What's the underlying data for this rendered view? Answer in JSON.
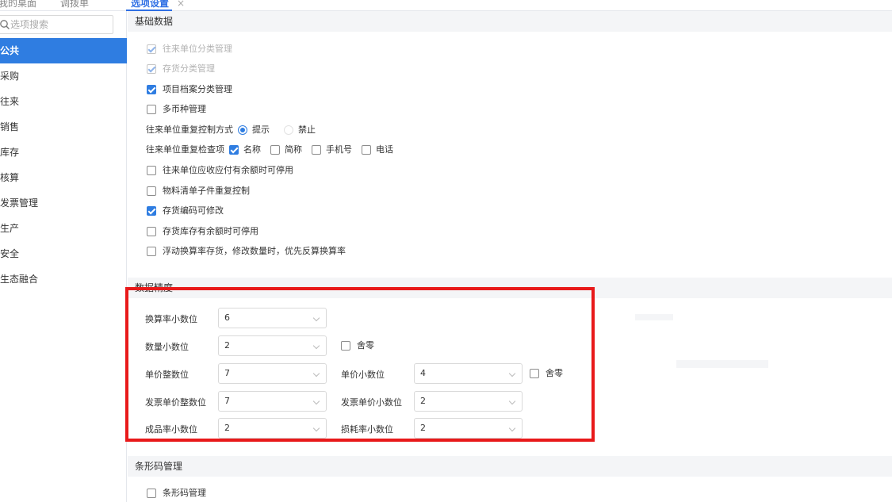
{
  "tabs": {
    "desktop": "我的桌面",
    "transfer": "调拨单",
    "options": "选项设置",
    "close_glyph": "×"
  },
  "sidebar": {
    "search_placeholder": "选项搜索",
    "items": [
      "公共",
      "采购",
      "往来",
      "销售",
      "库存",
      "核算",
      "发票管理",
      "生产",
      "安全",
      "生态融合"
    ],
    "active_index": 0
  },
  "basic": {
    "title": "基础数据",
    "partner_category": "往来单位分类管理",
    "inventory_category": "存货分类管理",
    "project_category": "项目档案分类管理",
    "multi_currency": "多币种管理",
    "dup_control_label": "往来单位重复控制方式",
    "dup_control_options": [
      "提示",
      "禁止"
    ],
    "dup_check_label": "往来单位重复检查项",
    "dup_check_options": [
      "名称",
      "简称",
      "手机号",
      "电话"
    ],
    "disable_with_balance": "往来单位应收应付有余额时可停用",
    "bom_child_dup": "物料清单子件重复控制",
    "inv_code_editable": "存货编码可修改",
    "inv_disable_with_stock": "存货库存有余额时可停用",
    "floating_rate": "浮动换算率存货，修改数量时，优先反算换算率"
  },
  "precision": {
    "title": "数据精度",
    "conversion_rate_decimals": {
      "label": "换算率小数位",
      "value": "6"
    },
    "quantity_decimals": {
      "label": "数量小数位",
      "value": "2"
    },
    "quantity_round_off": "舍零",
    "unit_price_integer": {
      "label": "单价整数位",
      "value": "7"
    },
    "unit_price_decimals": {
      "label": "单价小数位",
      "value": "4"
    },
    "unit_price_round_off": "舍零",
    "invoice_price_integer": {
      "label": "发票单价整数位",
      "value": "7"
    },
    "invoice_price_decimals": {
      "label": "发票单价小数位",
      "value": "2"
    },
    "yield_rate_decimals": {
      "label": "成品率小数位",
      "value": "2"
    },
    "loss_rate_decimals": {
      "label": "损耗率小数位",
      "value": "2"
    }
  },
  "barcode": {
    "title": "条形码管理",
    "enable": "条形码管理"
  },
  "colors": {
    "accent": "#2f7de1",
    "highlight_box": "#e8191a",
    "section_bg": "#f4f5f7"
  }
}
